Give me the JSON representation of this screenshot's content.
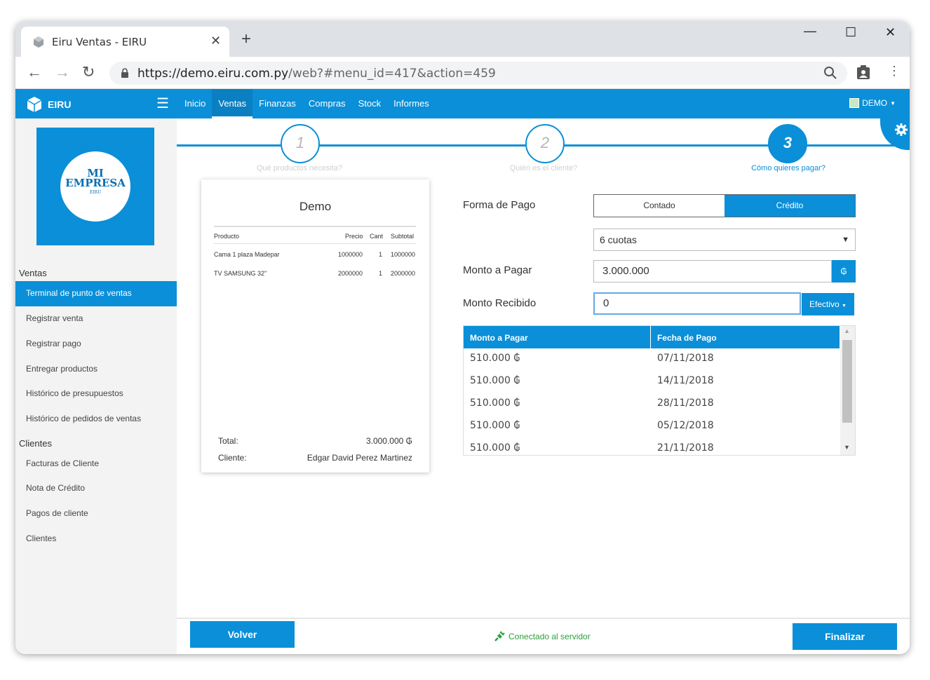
{
  "browser": {
    "tab_title": "Eiru Ventas - EIRU",
    "url_host": "https://demo.eiru.com.py",
    "url_path": "/web?#menu_id=417&action=459"
  },
  "app": {
    "brand": "EIRU",
    "nav": [
      "Inicio",
      "Ventas",
      "Finanzas",
      "Compras",
      "Stock",
      "Informes"
    ],
    "active_nav": "Ventas",
    "user": "DEMO"
  },
  "logo": {
    "line1": "MI",
    "line2": "EMPRESA",
    "line3": "EIRU"
  },
  "sidebar": {
    "ventas_header": "Ventas",
    "ventas_items": [
      "Terminal de punto de ventas",
      "Registrar venta",
      "Registrar pago",
      "Entregar productos",
      "Histórico de presupuestos",
      "Histórico de pedidos de ventas"
    ],
    "clientes_header": "Clientes",
    "clientes_items": [
      "Facturas de Cliente",
      "Nota de Crédito",
      "Pagos de cliente",
      "Clientes"
    ]
  },
  "steps": [
    {
      "num": "1",
      "label": "Qué productos necesita?"
    },
    {
      "num": "2",
      "label": "Quién es el cliente?"
    },
    {
      "num": "3",
      "label": "Cómo quieres pagar?"
    }
  ],
  "receipt": {
    "title": "Demo",
    "headers": {
      "product": "Producto",
      "price": "Precio",
      "qty": "Cant",
      "subtotal": "Subtotal"
    },
    "rows": [
      {
        "product": "Cama 1 plaza Madepar",
        "price": "1000000",
        "qty": "1",
        "subtotal": "1000000"
      },
      {
        "product": "TV SAMSUNG 32\"",
        "price": "2000000",
        "qty": "1",
        "subtotal": "2000000"
      }
    ],
    "total_label": "Total:",
    "total_value": "3.000.000 ₲",
    "client_label": "Cliente:",
    "client_value": "Edgar David Perez Martinez"
  },
  "payment": {
    "forma_label": "Forma de Pago",
    "option_contado": "Contado",
    "option_credito": "Crédito",
    "cuotas": "6 cuotas",
    "monto_pagar_label": "Monto a Pagar",
    "monto_pagar_value": "3.000.000",
    "currency_symbol": "₲",
    "monto_recibido_label": "Monto Recibido",
    "monto_recibido_value": "0",
    "method": "Efectivo"
  },
  "installments": {
    "col_amount": "Monto a Pagar",
    "col_date": "Fecha de Pago",
    "rows": [
      {
        "amount": "510.000 ₲",
        "date": "07/11/2018"
      },
      {
        "amount": "510.000 ₲",
        "date": "14/11/2018"
      },
      {
        "amount": "510.000 ₲",
        "date": "28/11/2018"
      },
      {
        "amount": "510.000 ₲",
        "date": "05/12/2018"
      },
      {
        "amount": "510.000 ₲",
        "date": "21/11/2018"
      }
    ]
  },
  "footer": {
    "back": "Volver",
    "status": "Conectado al servidor",
    "finish": "Finalizar"
  },
  "colors": {
    "primary": "#0a8fd8",
    "status_green": "#2e9e3f"
  }
}
